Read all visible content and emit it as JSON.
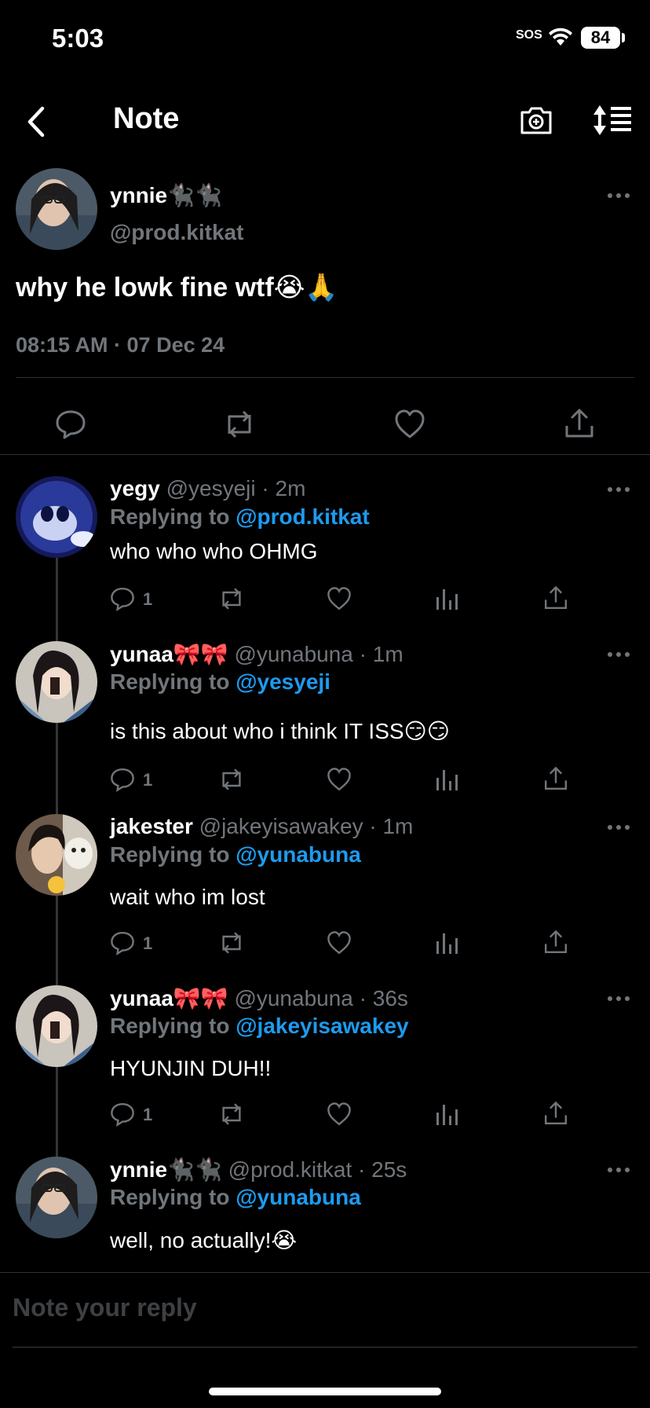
{
  "status": {
    "time": "5:03",
    "sos": "SOS",
    "battery": "84"
  },
  "header": {
    "title": "Note",
    "back_icon": "chevron-left-icon",
    "camera_icon": "camera-add-icon",
    "sort_icon": "sort-icon"
  },
  "main_post": {
    "name": "ynnie🐈‍⬛🐈‍⬛",
    "handle": "@prod.kitkat",
    "text": "why he lowk fine wtf😭🙏",
    "timestamp": "08:15 AM · 07 Dec 24"
  },
  "replies": [
    {
      "name": "yegy",
      "meta": "@yesyeji · 2m",
      "replying_label": "Replying to",
      "replying_to": "@prod.kitkat",
      "text": "who who who OHMG",
      "reply_count": "1"
    },
    {
      "name": "yunaa🎀🎀",
      "meta": "@yunabuna · 1m",
      "replying_label": "Replying to",
      "replying_to": "@yesyeji",
      "text": "is this about who i think IT ISS😏😏",
      "reply_count": "1"
    },
    {
      "name": "jakester",
      "meta": "@jakeyisawakey · 1m",
      "replying_label": "Replying to",
      "replying_to": "@yunabuna",
      "text": "wait who im lost",
      "reply_count": "1"
    },
    {
      "name": "yunaa🎀🎀",
      "meta": "@yunabuna · 36s",
      "replying_label": "Replying to",
      "replying_to": "@jakeyisawakey",
      "text": "HYUNJIN DUH!!",
      "reply_count": "1"
    },
    {
      "name": "ynnie🐈‍⬛🐈‍⬛",
      "meta": "@prod.kitkat · 25s",
      "replying_label": "Replying to",
      "replying_to": "@yunabuna",
      "text": "well, no actually!😭"
    }
  ],
  "composer": {
    "placeholder": "Note your reply"
  },
  "colors": {
    "background": "#000000",
    "accent": "#1d9bf0",
    "muted": "#71767b",
    "divider": "#2f3336"
  }
}
